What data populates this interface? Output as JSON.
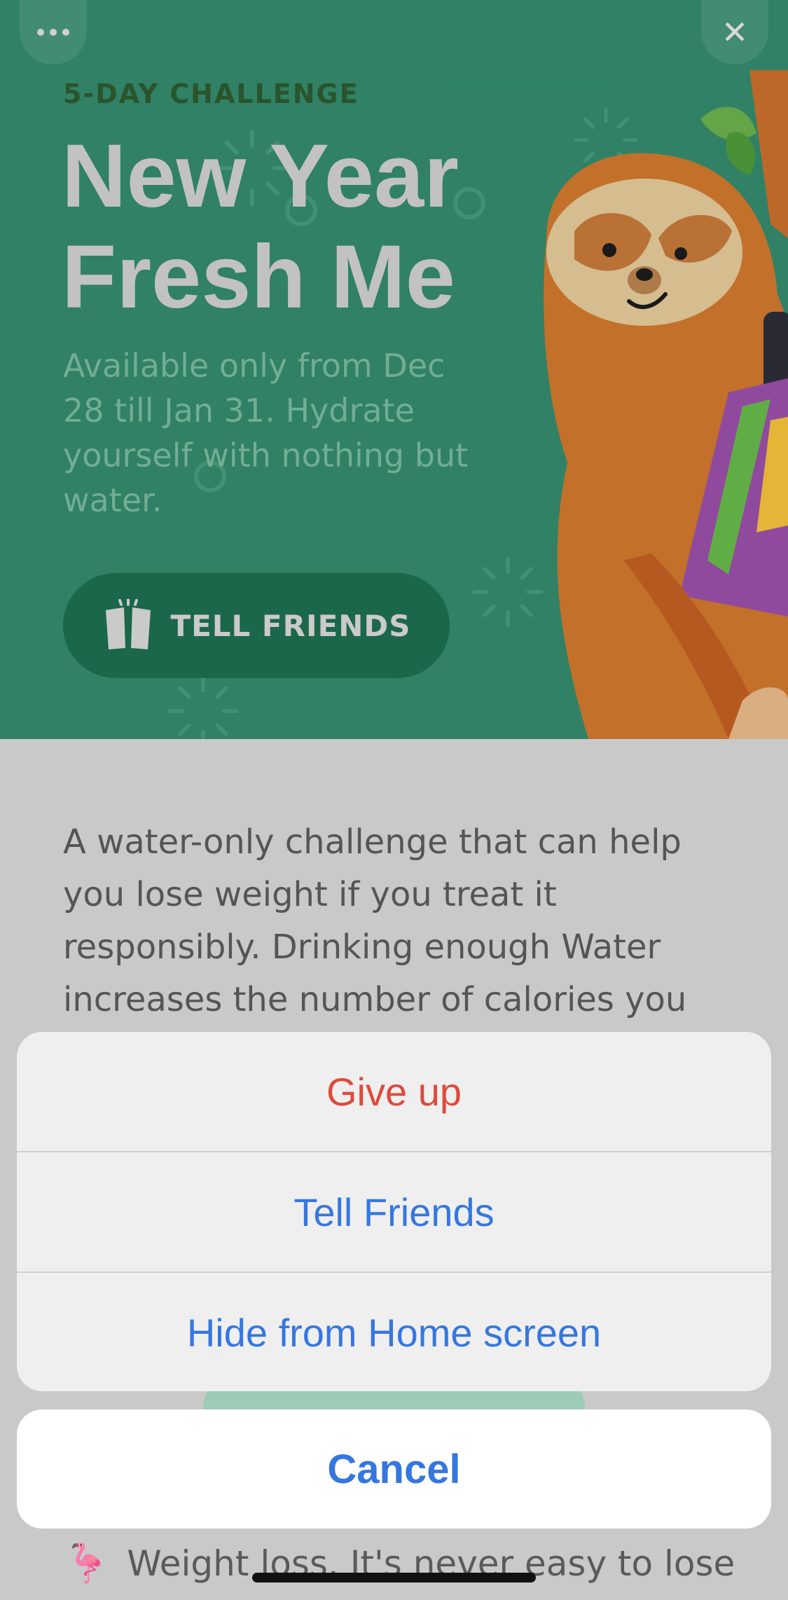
{
  "hero": {
    "eyebrow": "5-DAY CHALLENGE",
    "title_line1": "New Year",
    "title_line2": "Fresh Me",
    "subtitle": "Available only from Dec 28 till Jan 31. Hydrate yourself with nothing but water.",
    "tell_friends_label": "TELL FRIENDS",
    "background_color": "#338a6c"
  },
  "icons": {
    "more": "more-dots-icon",
    "close": "close-icon",
    "cheers": "cheers-glasses-icon",
    "flamingo": "flamingo-emoji"
  },
  "content": {
    "description": "A water-only challenge that can help you lose weight if you treat it responsibly. Drinking enough Water increases the number of calories you",
    "bottom_text": "Weight loss. It's never easy to lose"
  },
  "action_sheet": {
    "items": [
      {
        "label": "Give up",
        "style": "destructive"
      },
      {
        "label": "Tell Friends",
        "style": "default"
      },
      {
        "label": "Hide from Home screen",
        "style": "default"
      }
    ],
    "cancel_label": "Cancel"
  },
  "colors": {
    "accent_blue": "#3577e0",
    "destructive_red": "#de4a3c",
    "button_green": "#1d6e4f"
  }
}
